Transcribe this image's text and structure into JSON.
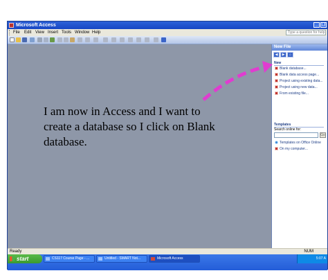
{
  "window": {
    "title": "Microsoft Access",
    "min_glyph": "_",
    "max_glyph": "❐"
  },
  "menu": {
    "items": [
      "File",
      "Edit",
      "View",
      "Insert",
      "Tools",
      "Window",
      "Help"
    ],
    "help_placeholder": "Type a question for help"
  },
  "task_pane": {
    "title": "New File",
    "nav": [
      "◀",
      "▶",
      "⌂"
    ],
    "new_section": "New",
    "new_items": [
      "Blank database...",
      "Blank data access page...",
      "Project using existing data...",
      "Project using new data...",
      "From existing file..."
    ],
    "templates_section": "Templates",
    "search_label": "Search online for:",
    "go_label": "Go",
    "template_items": [
      "Templates on Office Online",
      "On my computer..."
    ]
  },
  "status": {
    "left": "Ready",
    "num": "NUM"
  },
  "taskbar": {
    "start": "start",
    "tasks": [
      "CS117 Course Page - ...",
      "Untitled - SMART Not...",
      "Microsoft Access"
    ],
    "clock": "5:07 A"
  },
  "annotation": {
    "text": "I am now in Access and I want to create a database so I click on Blank database.",
    "arrow_color": "#e03cd0"
  }
}
